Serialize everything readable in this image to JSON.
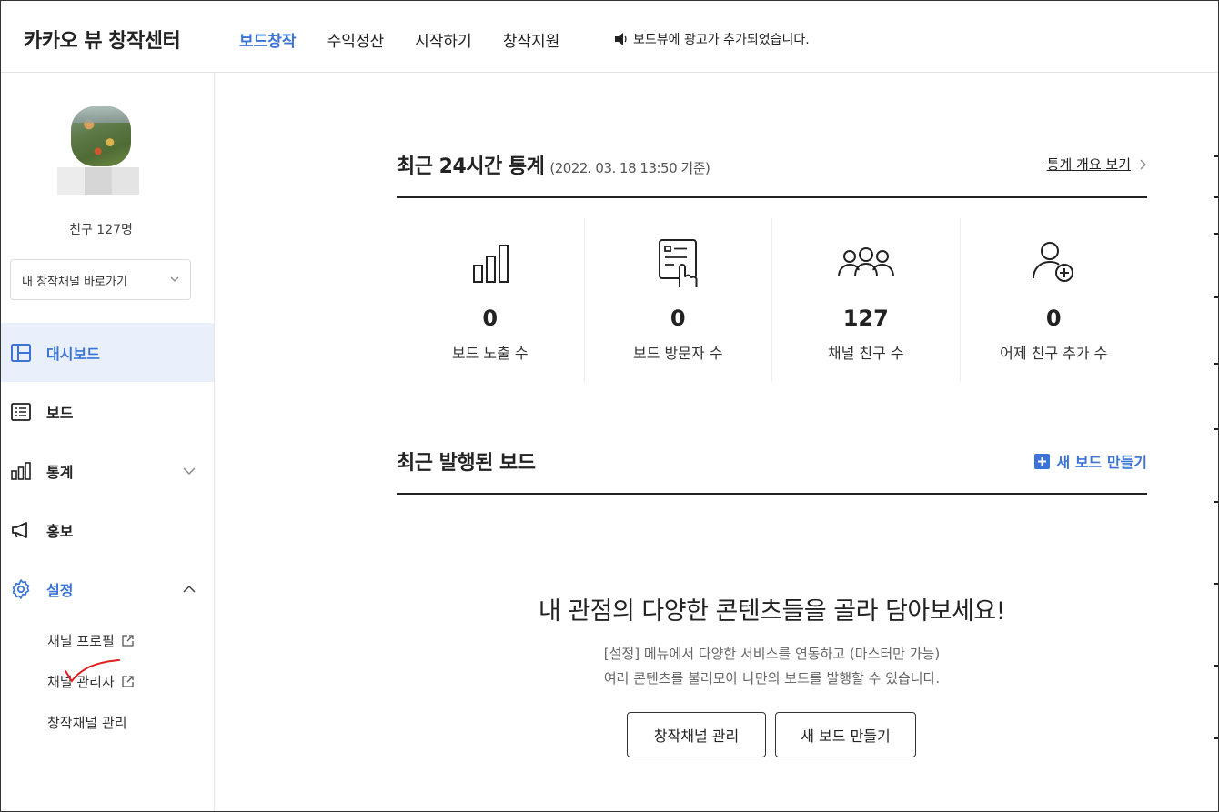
{
  "header": {
    "logo": "카카오 뷰 창작센터",
    "nav": [
      "보드창작",
      "수익정산",
      "시작하기",
      "창작지원"
    ],
    "notice": "보드뷰에 광고가 추가되었습니다."
  },
  "sidebar": {
    "friends": "친구 127명",
    "channel_select": "내 창작채널 바로가기",
    "menu": {
      "dashboard": "대시보드",
      "board": "보드",
      "stats": "통계",
      "promo": "홍보",
      "settings": "설정"
    },
    "sub": {
      "profile": "채널 프로필",
      "admin": "채널 관리자",
      "manage": "창작채널 관리"
    }
  },
  "stats_section": {
    "title": "최근 24시간 통계",
    "timestamp": "(2022. 03. 18 13:50 기준)",
    "link": "통계 개요 보기",
    "items": [
      {
        "value": "0",
        "label": "보드 노출 수",
        "icon": "bar-chart-icon"
      },
      {
        "value": "0",
        "label": "보드 방문자 수",
        "icon": "visitor-tap-icon"
      },
      {
        "value": "127",
        "label": "채널 친구 수",
        "icon": "people-icon"
      },
      {
        "value": "0",
        "label": "어제 친구 추가 수",
        "icon": "add-friend-icon"
      }
    ]
  },
  "boards_section": {
    "title": "최근 발행된 보드",
    "new_board": "새 보드 만들기",
    "empty_title": "내 관점의 다양한 콘텐츠들을 골라 담아보세요!",
    "empty_desc_1": "[설정] 메뉴에서 다양한 서비스를 연동하고 (마스터만 가능)",
    "empty_desc_2": "여러 콘텐츠를 불러모아 나만의 보드를 발행할 수 있습니다.",
    "btn_manage": "창작채널 관리",
    "btn_new": "새 보드 만들기"
  },
  "colors": {
    "accent": "#3b74d6",
    "active_bg": "#eaf0fb"
  }
}
